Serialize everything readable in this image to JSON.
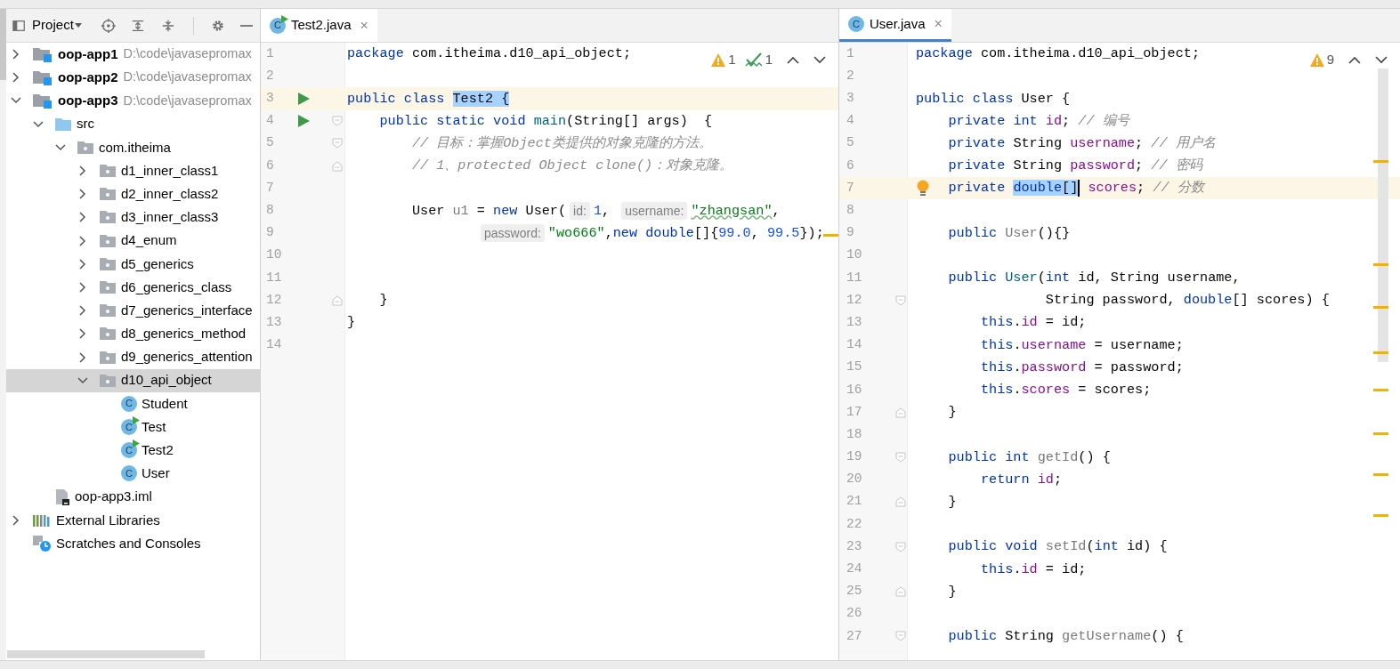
{
  "project_view": {
    "title": "Project",
    "tree": [
      {
        "kind": "module",
        "label": "oop-app1",
        "path": "D:\\code\\javasepromax",
        "expanded": false,
        "selected": false
      },
      {
        "kind": "module",
        "label": "oop-app2",
        "path": "D:\\code\\javasepromax",
        "expanded": false,
        "selected": false
      },
      {
        "kind": "module",
        "label": "oop-app3",
        "path": "D:\\code\\javasepromax",
        "expanded": true,
        "selected": false,
        "children": [
          {
            "kind": "source-folder",
            "label": "src",
            "expanded": true,
            "selected": false,
            "children": [
              {
                "kind": "package",
                "label": "com.itheima",
                "expanded": true,
                "selected": false,
                "children": [
                  {
                    "kind": "package",
                    "label": "d1_inner_class1",
                    "expanded": false,
                    "selected": false
                  },
                  {
                    "kind": "package",
                    "label": "d2_inner_class2",
                    "expanded": false,
                    "selected": false
                  },
                  {
                    "kind": "package",
                    "label": "d3_inner_class3",
                    "expanded": false,
                    "selected": false
                  },
                  {
                    "kind": "package",
                    "label": "d4_enum",
                    "expanded": false,
                    "selected": false
                  },
                  {
                    "kind": "package",
                    "label": "d5_generics",
                    "expanded": false,
                    "selected": false
                  },
                  {
                    "kind": "package",
                    "label": "d6_generics_class",
                    "expanded": false,
                    "selected": false
                  },
                  {
                    "kind": "package",
                    "label": "d7_generics_interface",
                    "expanded": false,
                    "selected": false
                  },
                  {
                    "kind": "package",
                    "label": "d8_generics_method",
                    "expanded": false,
                    "selected": false
                  },
                  {
                    "kind": "package",
                    "label": "d9_generics_attention",
                    "expanded": false,
                    "selected": false
                  },
                  {
                    "kind": "package",
                    "label": "d10_api_object",
                    "expanded": true,
                    "selected": true,
                    "children": [
                      {
                        "kind": "class",
                        "icon_text": "C",
                        "label": "Student",
                        "selected": false
                      },
                      {
                        "kind": "runnable-class",
                        "icon_text": "C",
                        "label": "Test",
                        "selected": false
                      },
                      {
                        "kind": "runnable-class",
                        "icon_text": "C",
                        "label": "Test2",
                        "selected": false
                      },
                      {
                        "kind": "class",
                        "icon_text": "C",
                        "label": "User",
                        "selected": false
                      }
                    ]
                  }
                ]
              }
            ]
          },
          {
            "kind": "module-file",
            "label": "oop-app3.iml",
            "selected": false
          }
        ]
      },
      {
        "kind": "libraries",
        "label": "External Libraries",
        "expanded": false,
        "selected": false
      },
      {
        "kind": "scratches",
        "label": "Scratches and Consoles",
        "selected": false
      }
    ]
  },
  "editors": [
    {
      "tab": {
        "label": "Test2.java",
        "kind": "runnable-class",
        "icon_text": "C",
        "close": "×",
        "selected": false
      },
      "inspections": [
        {
          "kind": "warning",
          "count": "1"
        },
        {
          "kind": "typo",
          "count": "1"
        }
      ],
      "lines": [
        {
          "number": "1",
          "current": false,
          "tokens": [
            {
              "kind": "keyword",
              "text": "package"
            },
            {
              "kind": "plain",
              "text": " com.itheima.d10_api_object;"
            }
          ]
        },
        {
          "number": "2",
          "current": false
        },
        {
          "number": "3",
          "current": true,
          "gutter": {
            "kind": "run"
          },
          "tokens": [
            {
              "kind": "keyword",
              "text": "public"
            },
            {
              "kind": "keyword",
              "text": " class "
            },
            {
              "kind": "plain-sel",
              "text": "Test2 {"
            }
          ]
        },
        {
          "number": "4",
          "current": false,
          "gutter": {
            "kind": "run"
          },
          "fold": {
            "kind": "start"
          },
          "tokens": [
            {
              "kind": "keyword",
              "text": "    public"
            },
            {
              "kind": "keyword",
              "text": " static"
            },
            {
              "kind": "keyword",
              "text": " void"
            },
            {
              "kind": "decl",
              "text": " main"
            },
            {
              "kind": "plain",
              "text": "(String[] args)  {"
            }
          ]
        },
        {
          "number": "5",
          "current": false,
          "fold": {
            "kind": "start"
          },
          "tokens": [
            {
              "kind": "comment",
              "text": "        // 目标：掌握Object类提供的对象克隆的方法。"
            }
          ]
        },
        {
          "number": "6",
          "current": false,
          "fold": {
            "kind": "end"
          },
          "tokens": [
            {
              "kind": "comment",
              "text": "        // 1、protected Object clone()：对象克隆。"
            }
          ]
        },
        {
          "number": "7",
          "current": false
        },
        {
          "number": "8",
          "current": false,
          "tokens": [
            {
              "kind": "plain",
              "text": "        User "
            },
            {
              "kind": "unused",
              "text": "u1"
            },
            {
              "kind": "plain",
              "text": " = "
            },
            {
              "kind": "keyword",
              "text": "new"
            },
            {
              "kind": "plain",
              "text": " User("
            },
            {
              "kind": "hint",
              "text": "id:"
            },
            {
              "kind": "number",
              "text": "1"
            },
            {
              "kind": "plain",
              "text": ", "
            },
            {
              "kind": "hint",
              "text": "username:"
            },
            {
              "kind": "typo",
              "text": "\"zhangsan\""
            },
            {
              "kind": "plain",
              "text": ","
            }
          ]
        },
        {
          "number": "9",
          "current": false,
          "continuation": true,
          "tokens": [
            {
              "kind": "hint",
              "text": "password:"
            },
            {
              "kind": "string",
              "text": "\"wo666\""
            },
            {
              "kind": "plain",
              "text": ","
            },
            {
              "kind": "keyword",
              "text": "new"
            },
            {
              "kind": "keyword",
              "text": " double"
            },
            {
              "kind": "plain",
              "text": "[]{"
            },
            {
              "kind": "number",
              "text": "99.0"
            },
            {
              "kind": "plain",
              "text": ", "
            },
            {
              "kind": "number",
              "text": "99.5"
            },
            {
              "kind": "plain",
              "text": "});"
            }
          ]
        },
        {
          "number": "10",
          "current": false
        },
        {
          "number": "11",
          "current": false
        },
        {
          "number": "12",
          "current": false,
          "fold": {
            "kind": "end"
          },
          "tokens": [
            {
              "kind": "plain",
              "text": "    }"
            }
          ]
        },
        {
          "number": "13",
          "current": false,
          "tokens": [
            {
              "kind": "plain",
              "text": "}"
            }
          ]
        },
        {
          "number": "14",
          "current": false
        }
      ]
    },
    {
      "tab": {
        "label": "User.java",
        "kind": "class",
        "icon_text": "C",
        "close": "×",
        "selected": true
      },
      "inspections": [
        {
          "kind": "warning",
          "count": "9"
        }
      ],
      "lines": [
        {
          "number": "1",
          "current": false,
          "tokens": [
            {
              "kind": "keyword",
              "text": "package"
            },
            {
              "kind": "plain",
              "text": " com.itheima.d10_api_object;"
            }
          ]
        },
        {
          "number": "2",
          "current": false
        },
        {
          "number": "3",
          "current": false,
          "tokens": [
            {
              "kind": "keyword",
              "text": "public"
            },
            {
              "kind": "keyword",
              "text": " class"
            },
            {
              "kind": "plain",
              "text": " User {"
            }
          ]
        },
        {
          "number": "4",
          "current": false,
          "tokens": [
            {
              "kind": "keyword",
              "text": "    private"
            },
            {
              "kind": "keyword",
              "text": " int"
            },
            {
              "kind": "field",
              "text": " id"
            },
            {
              "kind": "plain",
              "text": "; "
            },
            {
              "kind": "comment",
              "text": "// 编号"
            }
          ]
        },
        {
          "number": "5",
          "current": false,
          "tokens": [
            {
              "kind": "keyword",
              "text": "    private"
            },
            {
              "kind": "plain",
              "text": " String "
            },
            {
              "kind": "field",
              "text": "username"
            },
            {
              "kind": "plain",
              "text": "; "
            },
            {
              "kind": "comment",
              "text": "// 用户名"
            }
          ]
        },
        {
          "number": "6",
          "current": false,
          "tokens": [
            {
              "kind": "keyword",
              "text": "    private"
            },
            {
              "kind": "plain",
              "text": " String "
            },
            {
              "kind": "field",
              "text": "password"
            },
            {
              "kind": "plain",
              "text": "; "
            },
            {
              "kind": "comment",
              "text": "// 密码"
            }
          ]
        },
        {
          "number": "7",
          "current": true,
          "gutter": {
            "kind": "bulb"
          },
          "tokens": [
            {
              "kind": "keyword",
              "text": "    private "
            },
            {
              "kind": "keyword-sel",
              "text": "double"
            },
            {
              "kind": "plain-sel",
              "text": "[]"
            },
            {
              "kind": "caret"
            },
            {
              "kind": "field",
              "text": " scores"
            },
            {
              "kind": "plain",
              "text": "; "
            },
            {
              "kind": "comment",
              "text": "// 分数"
            }
          ]
        },
        {
          "number": "8",
          "current": false
        },
        {
          "number": "9",
          "current": false,
          "tokens": [
            {
              "kind": "keyword",
              "text": "    public"
            },
            {
              "kind": "unused",
              "text": " User"
            },
            {
              "kind": "plain",
              "text": "(){}"
            }
          ]
        },
        {
          "number": "10",
          "current": false
        },
        {
          "number": "11",
          "current": false,
          "tokens": [
            {
              "kind": "keyword",
              "text": "    public"
            },
            {
              "kind": "decl",
              "text": " User"
            },
            {
              "kind": "plain",
              "text": "("
            },
            {
              "kind": "keyword",
              "text": "int"
            },
            {
              "kind": "plain",
              "text": " id, String username,"
            }
          ]
        },
        {
          "number": "12",
          "current": false,
          "fold": {
            "kind": "start"
          },
          "tokens": [
            {
              "kind": "plain",
              "text": "                String password, "
            },
            {
              "kind": "keyword",
              "text": "double"
            },
            {
              "kind": "plain",
              "text": "[] scores) {"
            }
          ]
        },
        {
          "number": "13",
          "current": false,
          "tokens": [
            {
              "kind": "keyword",
              "text": "        this"
            },
            {
              "kind": "plain",
              "text": "."
            },
            {
              "kind": "field",
              "text": "id"
            },
            {
              "kind": "plain",
              "text": " = id;"
            }
          ]
        },
        {
          "number": "14",
          "current": false,
          "tokens": [
            {
              "kind": "keyword",
              "text": "        this"
            },
            {
              "kind": "plain",
              "text": "."
            },
            {
              "kind": "field",
              "text": "username"
            },
            {
              "kind": "plain",
              "text": " = username;"
            }
          ]
        },
        {
          "number": "15",
          "current": false,
          "tokens": [
            {
              "kind": "keyword",
              "text": "        this"
            },
            {
              "kind": "plain",
              "text": "."
            },
            {
              "kind": "field",
              "text": "password"
            },
            {
              "kind": "plain",
              "text": " = password;"
            }
          ]
        },
        {
          "number": "16",
          "current": false,
          "tokens": [
            {
              "kind": "keyword",
              "text": "        this"
            },
            {
              "kind": "plain",
              "text": "."
            },
            {
              "kind": "field",
              "text": "scores"
            },
            {
              "kind": "plain",
              "text": " = scores;"
            }
          ]
        },
        {
          "number": "17",
          "current": false,
          "fold": {
            "kind": "end"
          },
          "tokens": [
            {
              "kind": "plain",
              "text": "    }"
            }
          ]
        },
        {
          "number": "18",
          "current": false
        },
        {
          "number": "19",
          "current": false,
          "fold": {
            "kind": "start"
          },
          "tokens": [
            {
              "kind": "keyword",
              "text": "    public"
            },
            {
              "kind": "keyword",
              "text": " int"
            },
            {
              "kind": "unused",
              "text": " getId"
            },
            {
              "kind": "plain",
              "text": "() {"
            }
          ]
        },
        {
          "number": "20",
          "current": false,
          "tokens": [
            {
              "kind": "keyword",
              "text": "        return"
            },
            {
              "kind": "field",
              "text": " id"
            },
            {
              "kind": "plain",
              "text": ";"
            }
          ]
        },
        {
          "number": "21",
          "current": false,
          "fold": {
            "kind": "end"
          },
          "tokens": [
            {
              "kind": "plain",
              "text": "    }"
            }
          ]
        },
        {
          "number": "22",
          "current": false
        },
        {
          "number": "23",
          "current": false,
          "fold": {
            "kind": "start"
          },
          "tokens": [
            {
              "kind": "keyword",
              "text": "    public"
            },
            {
              "kind": "keyword",
              "text": " void"
            },
            {
              "kind": "unused",
              "text": " setId"
            },
            {
              "kind": "plain",
              "text": "("
            },
            {
              "kind": "keyword",
              "text": "int"
            },
            {
              "kind": "plain",
              "text": " id) {"
            }
          ]
        },
        {
          "number": "24",
          "current": false,
          "tokens": [
            {
              "kind": "keyword",
              "text": "        this"
            },
            {
              "kind": "plain",
              "text": "."
            },
            {
              "kind": "field",
              "text": "id"
            },
            {
              "kind": "plain",
              "text": " = id;"
            }
          ]
        },
        {
          "number": "25",
          "current": false,
          "fold": {
            "kind": "end"
          },
          "tokens": [
            {
              "kind": "plain",
              "text": "    }"
            }
          ]
        },
        {
          "number": "26",
          "current": false
        },
        {
          "number": "27",
          "current": false,
          "fold": {
            "kind": "start"
          },
          "tokens": [
            {
              "kind": "keyword",
              "text": "    public"
            },
            {
              "kind": "plain",
              "text": " String "
            },
            {
              "kind": "unused",
              "text": "getUsername"
            },
            {
              "kind": "plain",
              "text": "() {"
            }
          ]
        }
      ]
    }
  ]
}
